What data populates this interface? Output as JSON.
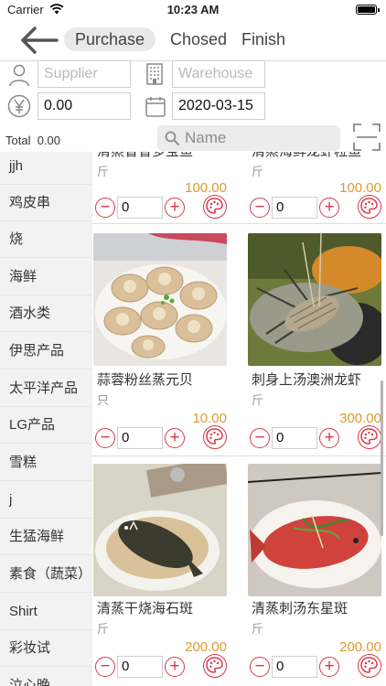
{
  "status_bar": {
    "carrier": "Carrier",
    "time": "10:23 AM"
  },
  "nav": {
    "tabs": [
      {
        "label": "Purchase",
        "active": true
      },
      {
        "label": "Chosed",
        "active": false
      },
      {
        "label": "Finish",
        "active": false
      }
    ]
  },
  "form": {
    "supplier_placeholder": "Supplier",
    "warehouse_placeholder": "Warehouse",
    "amount": "0.00",
    "date": "2020-03-15",
    "total_label": "Total",
    "total_value": "0.00",
    "search_placeholder": "Name"
  },
  "categories": [
    "jjh",
    "鸡皮串",
    "烧",
    "海鲜",
    "酒水类",
    "伊思产品",
    "太平洋产品",
    "LG产品",
    "雪糕",
    "j",
    "生猛海鲜",
    "素食（蔬菜）",
    "Shirt",
    "彩妆试",
    "泣心晚"
  ],
  "products": [
    {
      "name": "清蒸香香多宝鱼",
      "unit": "斤",
      "price": "100.00",
      "qty": "0",
      "photo": "fish-dish"
    },
    {
      "name": "清蒸海鲜龙虾粒鱼",
      "unit": "斤",
      "price": "100.00",
      "qty": "0",
      "photo": "lobster-dish"
    },
    {
      "name": "蒜蓉粉丝蒸元贝",
      "unit": "只",
      "price": "10.00",
      "qty": "0",
      "photo": "scallop-dish"
    },
    {
      "name": "刺身上汤澳洲龙虾",
      "unit": "斤",
      "price": "300.00",
      "qty": "0",
      "photo": "lobster-dish"
    },
    {
      "name": "清蒸干烧海石斑",
      "unit": "斤",
      "price": "200.00",
      "qty": "0",
      "photo": "fish-dish"
    },
    {
      "name": "清蒸刺汤东星斑",
      "unit": "斤",
      "price": "200.00",
      "qty": "0",
      "photo": "red-fish-dish"
    }
  ],
  "colors": {
    "accent": "#d83a4a",
    "price": "#e09a2c"
  }
}
